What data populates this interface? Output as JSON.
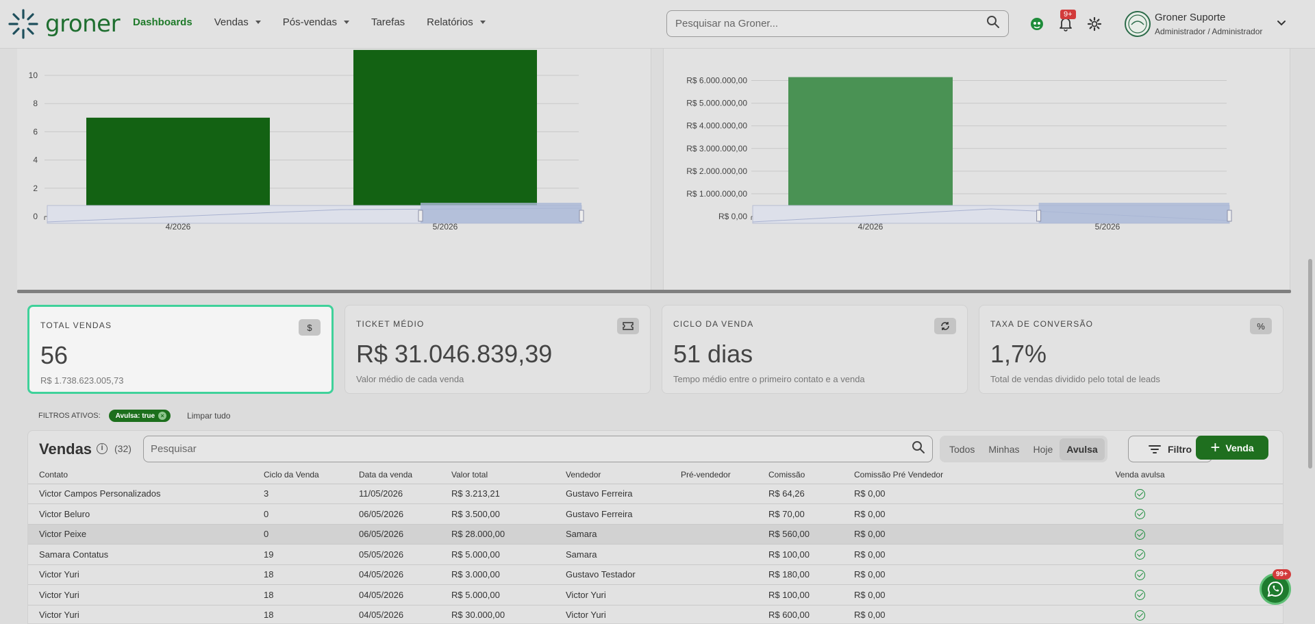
{
  "brand": {
    "name": "groner",
    "accent": "#1e6e2f"
  },
  "nav": {
    "items": [
      {
        "label": "Dashboards",
        "active": true,
        "dropdown": false
      },
      {
        "label": "Vendas",
        "active": false,
        "dropdown": true
      },
      {
        "label": "Pós-vendas",
        "active": false,
        "dropdown": true
      },
      {
        "label": "Tarefas",
        "active": false,
        "dropdown": false
      },
      {
        "label": "Relatórios",
        "active": false,
        "dropdown": true
      }
    ]
  },
  "search": {
    "placeholder": "Pesquisar na Groner..."
  },
  "notifications": {
    "badge": "9+"
  },
  "user": {
    "name": "Groner Suporte",
    "role": "Administrador / Administrador"
  },
  "chart_data": [
    {
      "type": "bar",
      "categories": [
        "4/2026",
        "5/2026"
      ],
      "values": [
        7,
        11.8
      ],
      "ylim": [
        0,
        12
      ],
      "yticks": [
        0,
        2,
        4,
        6,
        8,
        10
      ],
      "ytick_labels": [
        "0",
        "2",
        "4",
        "6",
        "8",
        "10"
      ],
      "color": "#136213",
      "grid": true
    },
    {
      "type": "bar",
      "categories": [
        "4/2026",
        "5/2026"
      ],
      "values": [
        6150000,
        420000
      ],
      "ylim": [
        0,
        6500000
      ],
      "yticks": [
        0,
        1000000,
        2000000,
        3000000,
        4000000,
        5000000,
        6000000
      ],
      "ytick_labels": [
        "R$ 0,00",
        "R$ 1.000.000,00",
        "R$ 2.000.000,00",
        "R$ 3.000.000,00",
        "R$ 4.000.000,00",
        "R$ 5.000.000,00",
        "R$ 6.000.000,00"
      ],
      "color": "#4a9254",
      "grid": true
    }
  ],
  "kpis": [
    {
      "label": "TOTAL VENDAS",
      "value": "56",
      "sub": "R$ 1.738.623.005,73",
      "icon": "$",
      "selected": true
    },
    {
      "label": "TICKET MÉDIO",
      "value": "R$ 31.046.839,39",
      "sub": "Valor médio de cada venda",
      "icon": "ticket",
      "selected": false
    },
    {
      "label": "CICLO DA VENDA",
      "value": "51 dias",
      "sub": "Tempo médio entre o primeiro contato e a venda",
      "icon": "cycle",
      "selected": false
    },
    {
      "label": "TAXA DE CONVERSÃO",
      "value": "1,7%",
      "sub": "Total de vendas dividido pelo total de leads",
      "icon": "%",
      "selected": false
    }
  ],
  "filters": {
    "label": "FILTROS ATIVOS:",
    "chip": "Avulsa: true",
    "clear": "Limpar tudo"
  },
  "table": {
    "title": "Vendas",
    "count": "(32)",
    "search_placeholder": "Pesquisar",
    "segments": [
      {
        "label": "Todos",
        "active": false
      },
      {
        "label": "Minhas",
        "active": false
      },
      {
        "label": "Hoje",
        "active": false
      },
      {
        "label": "Avulsa",
        "active": true
      }
    ],
    "filter_label": "Filtro",
    "new_label": "Venda",
    "columns": [
      "Contato",
      "Ciclo da Venda",
      "Data da venda",
      "Valor total",
      "Vendedor",
      "Pré-vendedor",
      "Comissão",
      "Comissão Pré Vendedor",
      "Venda avulsa"
    ],
    "rows": [
      [
        "Victor Campos Personalizados",
        "3",
        "11/05/2026",
        "R$ 3.213,21",
        "Gustavo Ferreira",
        "",
        "R$ 64,26",
        "R$ 0,00"
      ],
      [
        "Victor Beluro",
        "0",
        "06/05/2026",
        "R$ 3.500,00",
        "Gustavo Ferreira",
        "",
        "R$ 70,00",
        "R$ 0,00"
      ],
      [
        "Victor Peixe",
        "0",
        "06/05/2026",
        "R$ 28.000,00",
        "Samara",
        "",
        "R$ 560,00",
        "R$ 0,00"
      ],
      [
        "Samara Contatus",
        "19",
        "05/05/2026",
        "R$ 5.000,00",
        "Samara",
        "",
        "R$ 100,00",
        "R$ 0,00"
      ],
      [
        "Victor Yuri",
        "18",
        "04/05/2026",
        "R$ 3.000,00",
        "Gustavo Testador",
        "",
        "R$ 180,00",
        "R$ 0,00"
      ],
      [
        "Victor Yuri",
        "18",
        "04/05/2026",
        "R$ 5.000,00",
        "Victor Yuri",
        "",
        "R$ 100,00",
        "R$ 0,00"
      ],
      [
        "Victor Yuri",
        "18",
        "04/05/2026",
        "R$ 30.000,00",
        "Victor Yuri",
        "",
        "R$ 600,00",
        "R$ 0,00"
      ]
    ]
  },
  "whatsapp": {
    "badge": "99+"
  }
}
